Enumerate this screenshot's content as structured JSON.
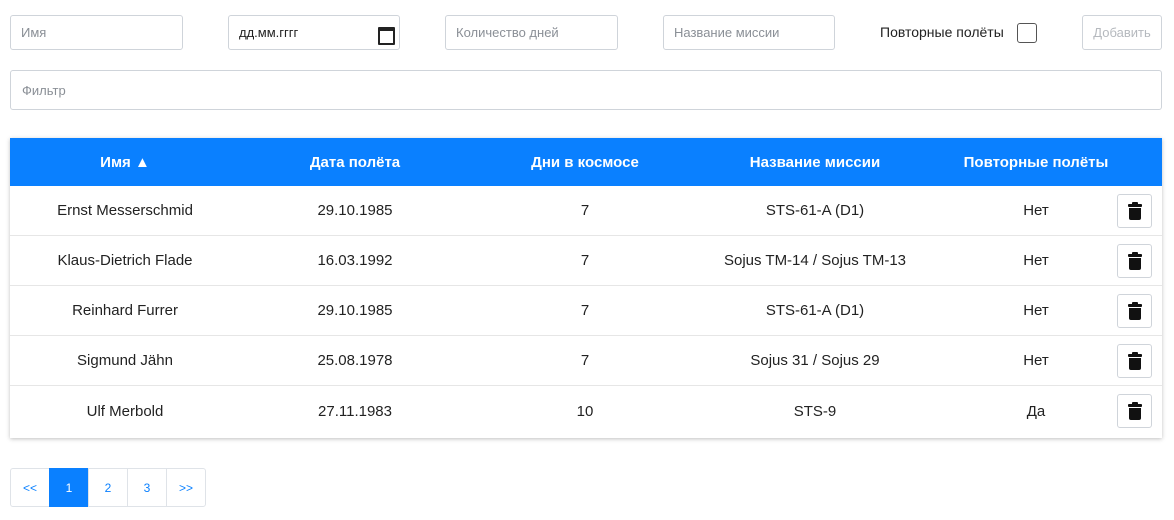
{
  "form": {
    "name_placeholder": "Имя",
    "date_placeholder": "дд.мм.гггг",
    "days_placeholder": "Количество дней",
    "mission_placeholder": "Название миссии",
    "repeat_label": "Повторные полёты",
    "repeat_checked": false,
    "add_label": "Добавить"
  },
  "filter": {
    "placeholder": "Фильтр"
  },
  "table": {
    "headers": [
      "Имя ▲",
      "Дата полёта",
      "Дни в космосе",
      "Название миссии",
      "Повторные полёты"
    ],
    "rows": [
      [
        "Ernst Messerschmid",
        "29.10.1985",
        "7",
        "STS-61-A (D1)",
        "Нет"
      ],
      [
        "Klaus-Dietrich Flade",
        "16.03.1992",
        "7",
        "Sojus TM-14 / Sojus TM-13",
        "Нет"
      ],
      [
        "Reinhard Furrer",
        "29.10.1985",
        "7",
        "STS-61-A (D1)",
        "Нет"
      ],
      [
        "Sigmund Jähn",
        "25.08.1978",
        "7",
        "Sojus 31 / Sojus 29",
        "Нет"
      ],
      [
        "Ulf Merbold",
        "27.11.1983",
        "10",
        "STS-9",
        "Да"
      ]
    ],
    "header_color": "#0a80ff"
  },
  "pagination": {
    "items": [
      "<<",
      "1",
      "2",
      "3",
      ">>"
    ],
    "active": "1"
  }
}
